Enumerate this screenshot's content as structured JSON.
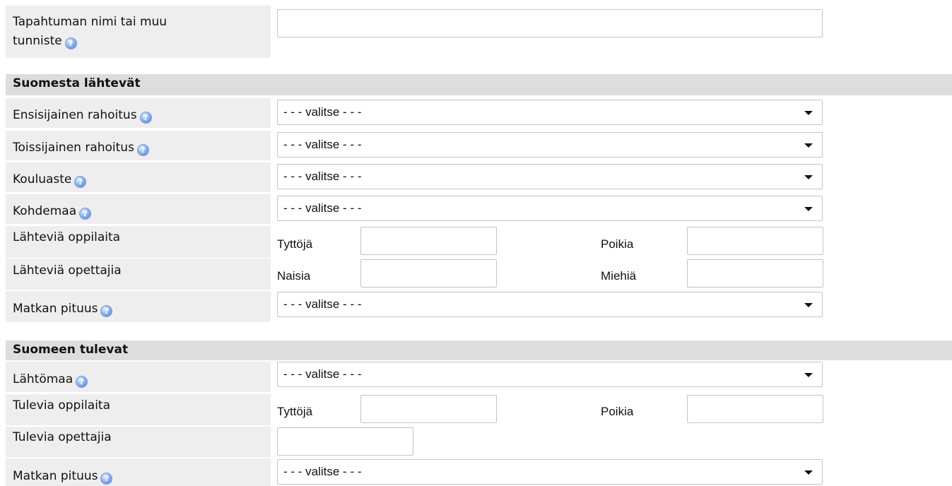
{
  "event": {
    "label_line1": "Tapahtuman nimi tai muu",
    "label_line2": "tunniste",
    "value": ""
  },
  "help_glyph": "?",
  "outgoing": {
    "header": "Suomesta lähtevät",
    "primary_funding": {
      "label": "Ensisijainen rahoitus",
      "value": "- - - valitse - - -"
    },
    "secondary_funding": {
      "label": "Toissijainen rahoitus",
      "value": "- - - valitse - - -"
    },
    "school_level": {
      "label": "Kouluaste",
      "value": "- - - valitse - - -"
    },
    "destination": {
      "label": "Kohdemaa",
      "value": "- - - valitse - - -"
    },
    "students": {
      "label": "Lähteviä oppilaita",
      "left_label": "Tyttöjä",
      "right_label": "Poikia",
      "left_value": "",
      "right_value": ""
    },
    "teachers": {
      "label": "Lähteviä opettajia",
      "left_label": "Naisia",
      "right_label": "Miehiä",
      "left_value": "",
      "right_value": ""
    },
    "trip_length": {
      "label": "Matkan pituus",
      "value": "- - - valitse - - -"
    }
  },
  "incoming": {
    "header": "Suomeen tulevat",
    "origin": {
      "label": "Lähtömaa",
      "value": "- - - valitse - - -"
    },
    "students": {
      "label": "Tulevia oppilaita",
      "left_label": "Tyttöjä",
      "right_label": "Poikia",
      "left_value": "",
      "right_value": ""
    },
    "teachers": {
      "label": "Tulevia opettajia",
      "value": ""
    },
    "trip_length": {
      "label": "Matkan pituus",
      "value": "- - - valitse - - -"
    }
  }
}
